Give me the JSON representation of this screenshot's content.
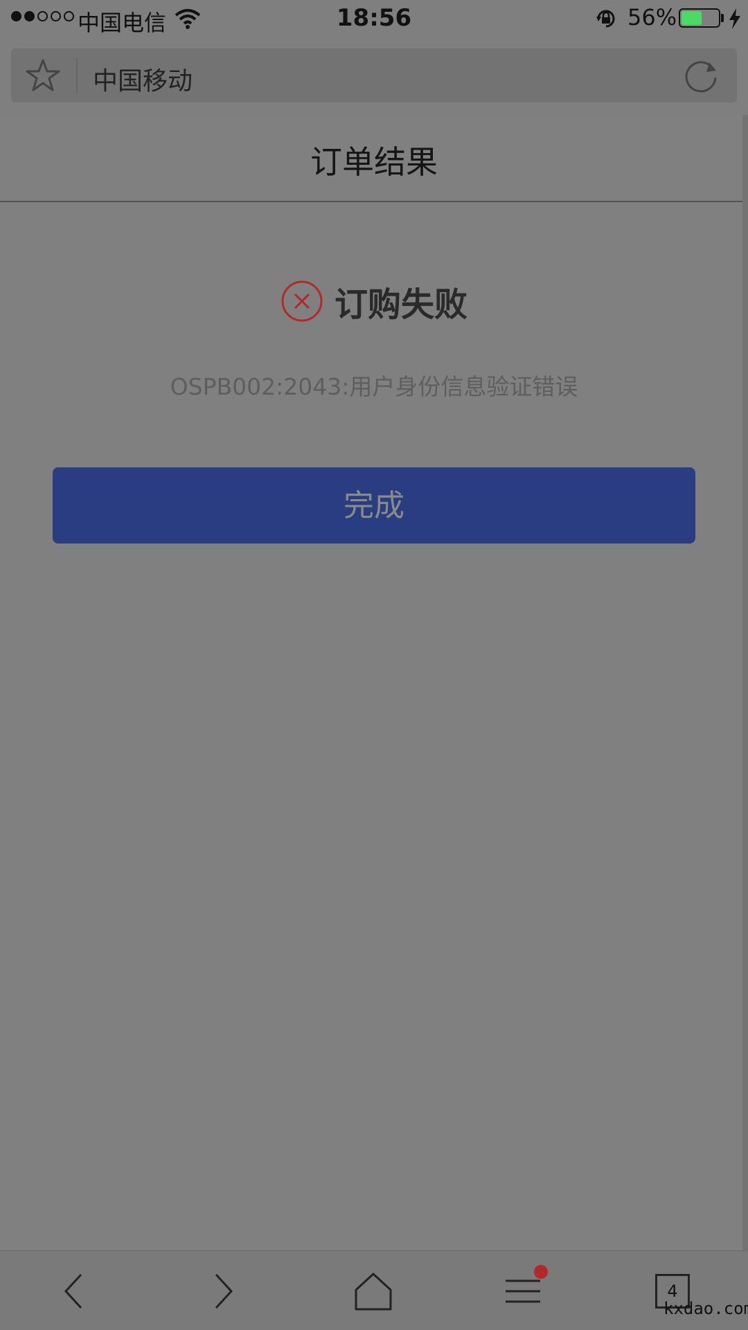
{
  "status_bar": {
    "carrier": "中国电信",
    "time": "18:56",
    "battery_percent": "56%",
    "battery_level": 0.56,
    "battery_color": "#4cd964"
  },
  "address_bar": {
    "site_title": "中国移动",
    "bookmark_icon": "star-icon",
    "reload_icon": "reload-icon"
  },
  "page": {
    "title": "订单结果",
    "result_title": "订购失败",
    "result_icon": "error-circle-icon",
    "error_message": "OSPB002:2043:用户身份信息验证错误",
    "done_button": "完成",
    "button_color": "#2a3d80",
    "error_color": "#b02a2a"
  },
  "toolbar": {
    "back_icon": "chevron-left-icon",
    "forward_icon": "chevron-right-icon",
    "home_icon": "home-icon",
    "menu_icon": "menu-icon",
    "tabs_count": "4"
  },
  "watermark": "kxdao.com"
}
